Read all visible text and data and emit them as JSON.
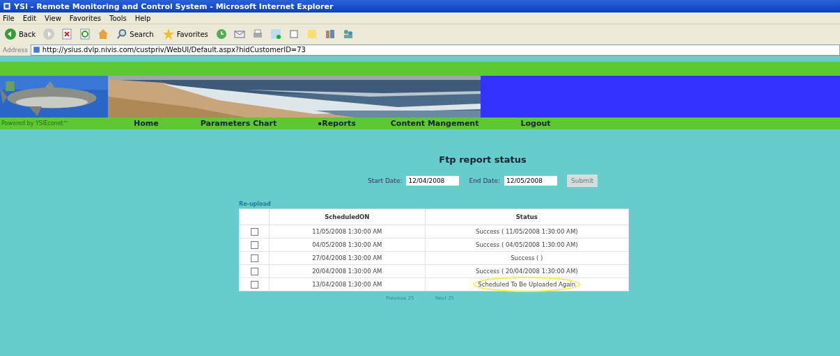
{
  "window": {
    "title": "YSI - Remote Monitoring and Control System - Microsoft Internet Explorer"
  },
  "menu": [
    "File",
    "Edit",
    "View",
    "Favorites",
    "Tools",
    "Help"
  ],
  "toolbar": {
    "back": "Back",
    "search": "Search",
    "favorites": "Favorites"
  },
  "address": {
    "label": "Address",
    "url": "http://ysius.dvlp.nivis.com/custpriv/WebUI/Default.aspx?hidCustomerID=73"
  },
  "site": {
    "powered_by": "Powered by YSIEconet™",
    "nav": [
      {
        "label": "Home",
        "selected": false
      },
      {
        "label": "Parameters Chart",
        "selected": false
      },
      {
        "label": "Reports",
        "selected": true
      },
      {
        "label": "Content Mangement",
        "selected": false
      },
      {
        "label": "Logout",
        "selected": false
      }
    ]
  },
  "page": {
    "title": "Ftp report status",
    "start": {
      "label": "Start Date:",
      "value": "12/04/2008"
    },
    "end": {
      "label": "End Date:",
      "value": "12/05/2008"
    },
    "submit": {
      "label": "Submit",
      "disabled": true
    },
    "reupload": "Re-upload",
    "table": {
      "columns": [
        "ScheduledON",
        "Status"
      ],
      "rows": [
        {
          "checked": false,
          "scheduled": "11/05/2008 1:30:00 AM",
          "status": "Success ( 11/05/2008 1:30:00 AM)",
          "highlighted": false
        },
        {
          "checked": false,
          "scheduled": "04/05/2008 1:30:00 AM",
          "status": "Success ( 04/05/2008 1:30:00 AM)",
          "highlighted": false
        },
        {
          "checked": false,
          "scheduled": "27/04/2008 1:30:00 AM",
          "status": "Success ( )",
          "highlighted": false
        },
        {
          "checked": false,
          "scheduled": "20/04/2008 1:30:00 AM",
          "status": "Success ( 20/04/2008 1:30:00 AM)",
          "highlighted": false
        },
        {
          "checked": false,
          "scheduled": "13/04/2008 1:30:00 AM",
          "status": "Scheduled To Be Uploaded Again",
          "highlighted": true
        }
      ]
    },
    "pager": [
      "Previous 25",
      "Next 25"
    ]
  }
}
